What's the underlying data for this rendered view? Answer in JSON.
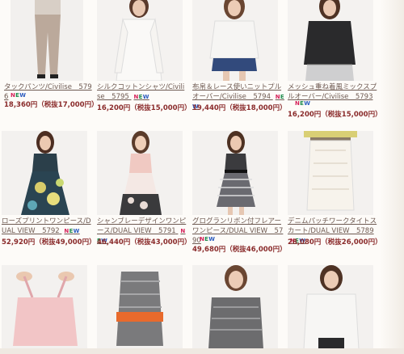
{
  "products": [
    {
      "name": "タックパンツ/Civilise　5796",
      "new": true,
      "price": "18,360円（税抜17,000円）"
    },
    {
      "name": "シルクコットンシャツ/Civilise　5795",
      "new": true,
      "price": "16,200円（税抜15,000円）"
    },
    {
      "name": "布帛＆レース使いニットプルオーバー/Civilise　5794",
      "new": true,
      "price": "19,440円（税抜18,000円）"
    },
    {
      "name": "メッシュ重ね着風ミックスプルオーバー/Civilise　5793",
      "new": true,
      "price": "16,200円（税抜15,000円）"
    },
    {
      "name": "ローズプリントワンピース/DUAL VIEW　5792",
      "new": true,
      "price": "52,920円（税抜49,000円）"
    },
    {
      "name": "シャンブレーデザインワンピース/DUAL VIEW　5791",
      "new": true,
      "price": "46,440円（税抜43,000円）"
    },
    {
      "name": "グログランリボン付フレアーワンピース/DUAL VIEW　5790",
      "new": true,
      "price": "49,680円（税抜46,000円）"
    },
    {
      "name": "デニムパッチワークタイトスカート/DUAL VIEW　5789",
      "new": true,
      "price": "28,080円（税抜26,000円）"
    }
  ],
  "new_badge": {
    "n": "N",
    "e": "E",
    "w": "W"
  }
}
